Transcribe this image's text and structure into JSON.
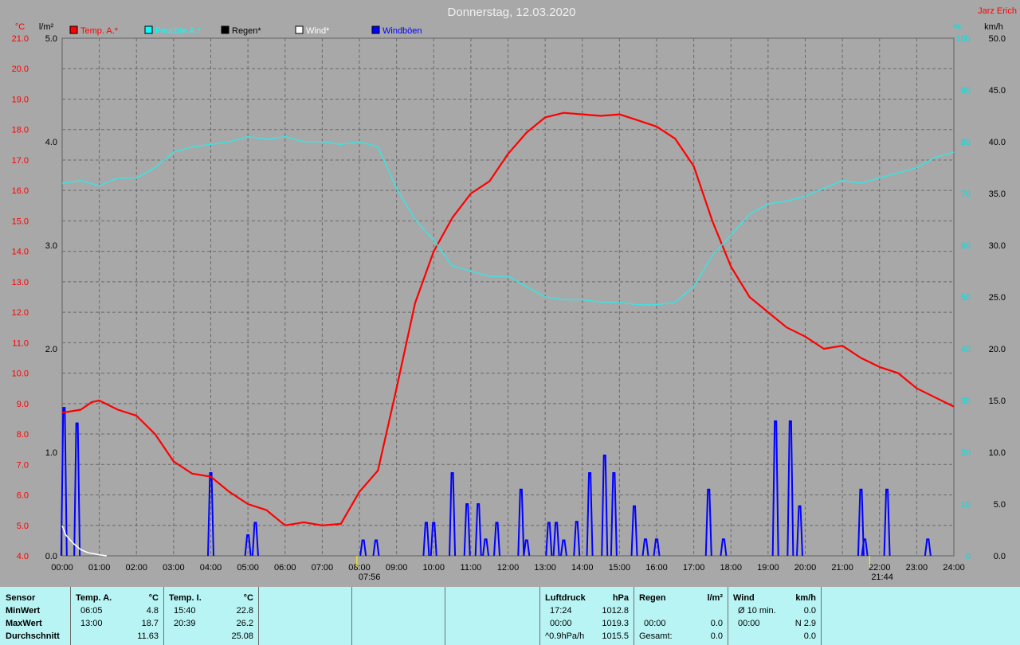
{
  "header": {
    "title": "Donnerstag, 12.03.2020",
    "author": "Jarz Erich"
  },
  "legend": [
    {
      "label": "Temp. A.*",
      "color": "#ff0000"
    },
    {
      "label": "Feuchte A.*",
      "color": "#00ffff"
    },
    {
      "label": "Regen*",
      "color": "#000000"
    },
    {
      "label": "Wind*",
      "color": "#ffffff"
    },
    {
      "label": "Windböen",
      "color": "#0000ff"
    }
  ],
  "axes": {
    "temp_unit": "°C",
    "rain_unit": "l/m²",
    "hum_unit": "%",
    "wind_unit": "km/h",
    "temp_ticks": [
      "21.0",
      "20.0",
      "19.0",
      "18.0",
      "17.0",
      "16.0",
      "15.0",
      "14.0",
      "13.0",
      "12.0",
      "11.0",
      "10.0",
      "9.0",
      "8.0",
      "7.0",
      "6.0",
      "5.0",
      "4.0"
    ],
    "rain_ticks": [
      "5.0",
      "4.0",
      "3.0",
      "2.0",
      "1.0",
      "0.0"
    ],
    "hum_ticks": [
      "100",
      "90",
      "80",
      "70",
      "60",
      "50",
      "40",
      "30",
      "20",
      "10",
      "0"
    ],
    "wind_ticks": [
      "50.0",
      "45.0",
      "40.0",
      "35.0",
      "30.0",
      "25.0",
      "20.0",
      "15.0",
      "10.0",
      "5.0",
      "0.0"
    ],
    "x_ticks": [
      "00:00",
      "01:00",
      "02:00",
      "03:00",
      "04:00",
      "05:00",
      "06:00",
      "07:00",
      "08:00",
      "09:00",
      "10:00",
      "11:00",
      "12:00",
      "13:00",
      "14:00",
      "15:00",
      "16:00",
      "17:00",
      "18:00",
      "19:00",
      "20:00",
      "21:00",
      "22:00",
      "23:00",
      "24:00"
    ],
    "sunrise": "07:56",
    "sunset": "21:44"
  },
  "chart_data": {
    "type": "line",
    "title": "Donnerstag, 12.03.2020",
    "xlabel": "",
    "ylabel": "°C",
    "ylim": [
      4.0,
      21.0
    ],
    "series": [
      {
        "name": "Temp. A.*",
        "axis": "temp",
        "color": "#ff0000",
        "x": [
          0,
          0.5,
          0.8,
          1.0,
          1.5,
          2.0,
          2.5,
          3.0,
          3.5,
          4.0,
          4.5,
          5.0,
          5.5,
          6.0,
          6.5,
          7.0,
          7.5,
          8.0,
          8.5,
          9.0,
          9.5,
          10.0,
          10.5,
          11.0,
          11.5,
          12.0,
          12.5,
          13.0,
          13.5,
          14.0,
          14.5,
          15.0,
          15.5,
          16.0,
          16.5,
          17.0,
          17.5,
          18.0,
          18.5,
          19.0,
          19.5,
          20.0,
          20.5,
          21.0,
          21.5,
          22.0,
          22.5,
          23.0,
          23.5,
          24.0
        ],
        "values": [
          8.7,
          8.8,
          9.05,
          9.1,
          8.8,
          8.6,
          8.0,
          7.1,
          6.7,
          6.6,
          6.1,
          5.7,
          5.5,
          5.0,
          5.1,
          5.0,
          5.05,
          6.1,
          6.8,
          9.5,
          12.3,
          14.0,
          15.1,
          15.9,
          16.3,
          17.2,
          17.9,
          18.4,
          18.55,
          18.5,
          18.45,
          18.5,
          18.3,
          18.1,
          17.7,
          16.8,
          15.0,
          13.5,
          12.5,
          12.0,
          11.5,
          11.2,
          10.8,
          10.9,
          10.5,
          10.2,
          10.0,
          9.5,
          9.2,
          8.9
        ]
      },
      {
        "name": "Feuchte A.*",
        "axis": "hum",
        "color": "#40e0e0",
        "x": [
          0,
          0.5,
          1.0,
          1.5,
          2.0,
          2.5,
          3.0,
          3.5,
          4.0,
          4.5,
          5.0,
          5.5,
          6.0,
          6.5,
          7.0,
          7.5,
          8.0,
          8.5,
          9.0,
          9.5,
          10.0,
          10.5,
          11.0,
          11.5,
          12.0,
          12.5,
          13.0,
          13.5,
          14.0,
          14.5,
          15.0,
          15.5,
          16.0,
          16.5,
          17.0,
          17.5,
          18.0,
          18.5,
          19.0,
          19.5,
          20.0,
          20.5,
          21.0,
          21.5,
          22.0,
          22.5,
          23.0,
          23.5,
          24.0
        ],
        "values": [
          72,
          72.5,
          71.5,
          73,
          73,
          75,
          78,
          79,
          79.5,
          80,
          81,
          80.5,
          81,
          80,
          80,
          79.5,
          80,
          79,
          71,
          65,
          61,
          56,
          55,
          54,
          54,
          52,
          50,
          49.5,
          49.5,
          49,
          49,
          48.5,
          48.5,
          49,
          52,
          58,
          62,
          66,
          68,
          68.5,
          69.5,
          71,
          72.5,
          72,
          73,
          74,
          75,
          77,
          78
        ]
      },
      {
        "name": "Wind*",
        "axis": "wind",
        "color": "#ffffff",
        "x": [
          0,
          0.1,
          0.3,
          0.5,
          0.7,
          1.0,
          1.2
        ],
        "values": [
          2.9,
          2.0,
          1.2,
          0.6,
          0.3,
          0.1,
          0.0
        ]
      }
    ],
    "gusts": {
      "name": "Windböen",
      "axis": "wind",
      "color": "#0000ff",
      "peaks": [
        [
          0.05,
          14.3
        ],
        [
          0.4,
          12.8
        ],
        [
          4.0,
          8.0
        ],
        [
          5.0,
          2.0
        ],
        [
          5.2,
          3.2
        ],
        [
          8.1,
          1.5
        ],
        [
          8.45,
          1.5
        ],
        [
          9.8,
          3.2
        ],
        [
          10.0,
          3.2
        ],
        [
          10.5,
          8.0
        ],
        [
          10.9,
          5.0
        ],
        [
          11.2,
          5.0
        ],
        [
          11.4,
          1.6
        ],
        [
          11.7,
          3.2
        ],
        [
          12.35,
          6.4
        ],
        [
          12.5,
          1.5
        ],
        [
          13.1,
          3.2
        ],
        [
          13.3,
          3.2
        ],
        [
          13.5,
          1.5
        ],
        [
          13.85,
          3.3
        ],
        [
          14.2,
          8.0
        ],
        [
          14.6,
          9.7
        ],
        [
          14.85,
          8.0
        ],
        [
          15.4,
          4.8
        ],
        [
          15.7,
          1.6
        ],
        [
          16.0,
          1.6
        ],
        [
          17.4,
          6.4
        ],
        [
          17.8,
          1.6
        ],
        [
          19.2,
          13.0
        ],
        [
          19.6,
          13.0
        ],
        [
          19.85,
          4.8
        ],
        [
          21.5,
          6.4
        ],
        [
          21.6,
          1.6
        ],
        [
          22.2,
          6.4
        ],
        [
          23.3,
          1.6
        ]
      ]
    }
  },
  "stats": {
    "sensor": "Sensor",
    "rows": [
      "MinWert",
      "MaxWert",
      "Durchschnitt"
    ],
    "temp_a": {
      "head": "Temp. A.",
      "unit": "°C",
      "min_time": "06:05",
      "min": "4.8",
      "max_time": "13:00",
      "max": "18.7",
      "avg": "11.63"
    },
    "temp_i": {
      "head": "Temp. I.",
      "unit": "°C",
      "min_time": "15:40",
      "min": "22.8",
      "max_time": "20:39",
      "max": "26.2",
      "avg": "25.08"
    },
    "pressure": {
      "head": "Luftdruck",
      "unit": "hPa",
      "min_time": "17:24",
      "min": "1012.8",
      "max_time": "00:00",
      "max": "1019.3",
      "trend_label": "^0.9hPa/h",
      "trend": "1015.5"
    },
    "rain": {
      "head": "Regen",
      "unit": "l/m²",
      "max_time": "00:00",
      "max": "0.0",
      "total_label": "Gesamt:",
      "total": "0.0"
    },
    "wind": {
      "head": "Wind",
      "unit": "km/h",
      "avg_label": "Ø 10 min.",
      "avg": "0.0",
      "max_time": "00:00",
      "max": "N 2.9",
      "day": "0.0"
    }
  }
}
